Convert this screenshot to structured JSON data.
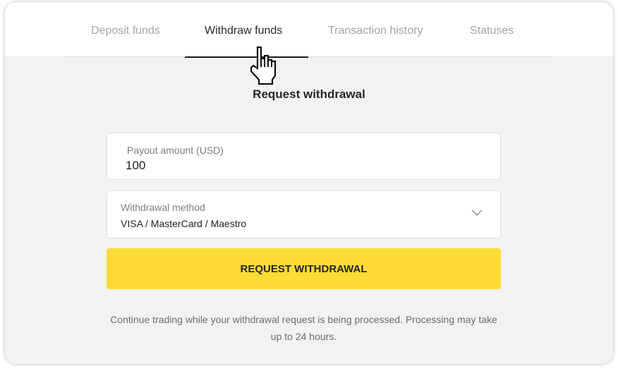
{
  "tabs": [
    {
      "label": "Deposit funds",
      "active": false
    },
    {
      "label": "Withdraw funds",
      "active": true
    },
    {
      "label": "Transaction history",
      "active": false
    },
    {
      "label": "Statuses",
      "active": false
    }
  ],
  "form": {
    "title": "Request withdrawal",
    "amount": {
      "label": "Payout amount (USD)",
      "value": "100"
    },
    "method": {
      "label": "Withdrawal method",
      "value": "VISA / MasterCard / Maestro",
      "icon": "chevron-down-icon"
    },
    "submit_label": "REQUEST WITHDRAWAL",
    "note": "Continue trading while your withdrawal request is being processed.  Processing may take up to 24 hours."
  },
  "colors": {
    "accent": "#fedc38",
    "page_background": "#f2f2f2",
    "active_tab": "#2a2a2a",
    "inactive_tab": "#a3a3a3"
  },
  "pointer": {
    "icon": "hand-pointer-icon"
  }
}
